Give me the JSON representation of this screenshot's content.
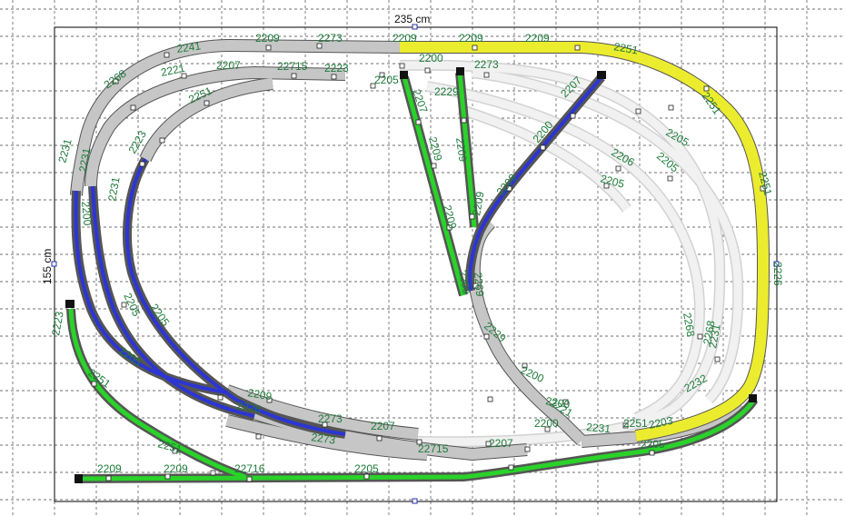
{
  "board": {
    "width_label": "235 cm",
    "height_label": "155 cm"
  },
  "colors": {
    "background": "#ffffff",
    "grid": "#6f6f6f",
    "board_border": "#000000",
    "track_gray": "#c4c4c4",
    "track_light": "#ececec",
    "track_green": "#22d322",
    "track_blue": "#1f2cd6",
    "track_yellow": "#eded30",
    "label": "#1e7b3a"
  },
  "track_labels": [
    "2241",
    "2209",
    "2273",
    "2209",
    "2209",
    "2209",
    "2251",
    "2268",
    "2221",
    "2207",
    "22715",
    "2223",
    "2200",
    "2273",
    "2205",
    "2207",
    "2229",
    "2207",
    "2251",
    "2251",
    "2200",
    "2205",
    "2206",
    "2205",
    "2205",
    "2231",
    "2223",
    "2209",
    "2209",
    "2209",
    "2209",
    "2251",
    "2231",
    "2200",
    "2231",
    "2209",
    "2226",
    "2209",
    "2268",
    "2205",
    "2205",
    "2200",
    "2269",
    "2268",
    "2223",
    "2205",
    "2251",
    "2229",
    "2209",
    "2273",
    "2200",
    "2226",
    "2207",
    "2273",
    "2200",
    "2232",
    "2231",
    "2251",
    "2231",
    "2221",
    "2251",
    "2205",
    "2203",
    "2209",
    "2209",
    "22716",
    "2205",
    "22715",
    "2207"
  ]
}
